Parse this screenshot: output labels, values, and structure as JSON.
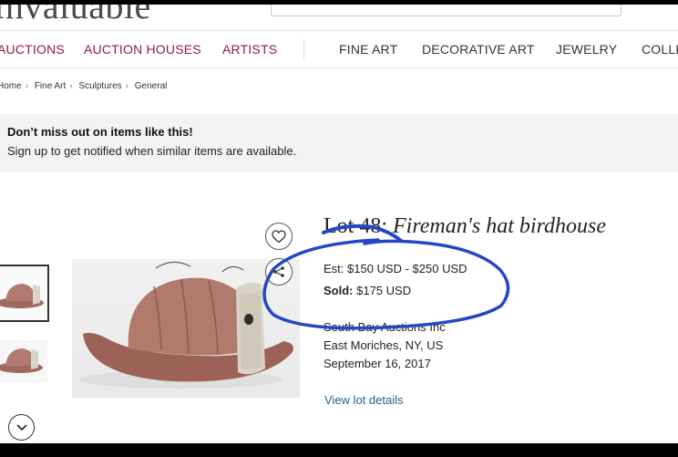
{
  "header": {
    "logo_text": "Invaluable",
    "search_placeholder": ""
  },
  "nav": {
    "items": [
      {
        "label": "AUCTIONS"
      },
      {
        "label": "AUCTION HOUSES"
      },
      {
        "label": "ARTISTS"
      },
      {
        "label": "FINE ART"
      },
      {
        "label": "DECORATIVE ART"
      },
      {
        "label": "JEWELRY"
      },
      {
        "label": "COLLE"
      }
    ]
  },
  "breadcrumb": [
    "Home",
    "Fine Art",
    "Sculptures",
    "General"
  ],
  "banner": {
    "title": "Don’t miss out on items like this!",
    "subtitle": "Sign up to get notified when similar items are available."
  },
  "lot": {
    "number_label": "Lot 48:",
    "title": "Fireman's hat birdhouse",
    "estimate": "Est: $150 USD - $250 USD",
    "sold_label": "Sold:",
    "sold_value": "$175 USD",
    "auction_house": "South Bay Auctions Inc",
    "location": "East Moriches, NY, US",
    "date": "September 16, 2017",
    "view_details": "View lot details"
  },
  "colors": {
    "nav_accent": "#8e1b3e",
    "link": "#2a5d8a",
    "annotation_ink": "#2447c4"
  },
  "icons": [
    "heart-icon",
    "share-icon",
    "chevron-down-icon",
    "breadcrumb-chevron-icon"
  ]
}
